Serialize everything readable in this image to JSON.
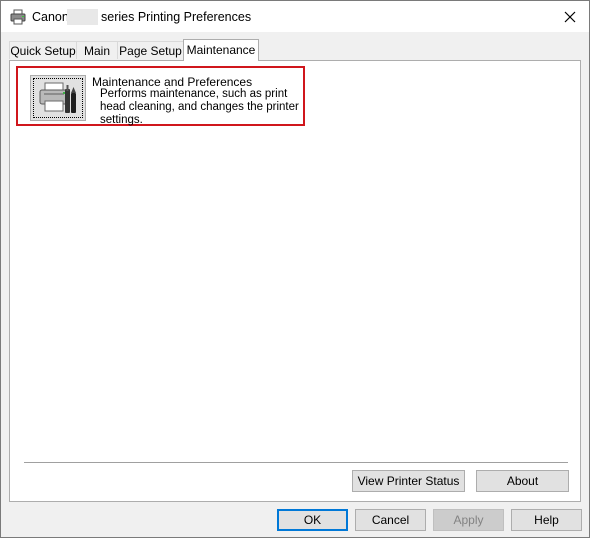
{
  "window": {
    "title_prefix": "Canon",
    "title_suffix": "series Printing Preferences",
    "close_glyph": "×"
  },
  "tabs": [
    {
      "label": "Quick Setup"
    },
    {
      "label": "Main"
    },
    {
      "label": "Page Setup"
    },
    {
      "label": "Maintenance"
    }
  ],
  "active_tab": "Maintenance",
  "maintenance": {
    "title": "Maintenance and Preferences",
    "description": "Performs maintenance, such as print head cleaning, and changes the printer settings.",
    "icon": "printer-tools-icon"
  },
  "panel_buttons": {
    "view_status": "View Printer Status",
    "about": "About"
  },
  "dialog_buttons": {
    "ok": "OK",
    "cancel": "Cancel",
    "apply": "Apply",
    "help": "Help"
  },
  "colors": {
    "highlight_border": "#d0161c",
    "default_button_border": "#0078d7",
    "dialog_background": "#f0f0f0"
  }
}
